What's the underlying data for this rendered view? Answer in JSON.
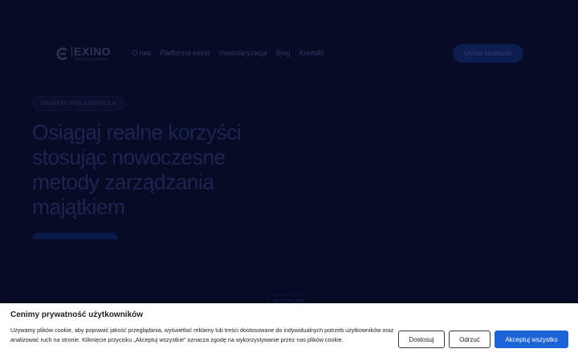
{
  "header": {
    "logo": {
      "name": "EXINO",
      "tagline": "business systems"
    },
    "nav": [
      {
        "label": "O nas"
      },
      {
        "label": "Platforma exino"
      },
      {
        "label": "Inwentaryzacja"
      },
      {
        "label": "Blog"
      },
      {
        "label": "Kontakt"
      }
    ],
    "cta_label": "Umów spotkanie"
  },
  "hero": {
    "badge": "MAJĄTEK POD KONTROLĄ",
    "title": "Osiągaj realne korzyści stosując nowoczesne metody zarządzania majątkiem"
  },
  "section": {
    "badge": "WYZWANIE"
  },
  "cookie_banner": {
    "title": "Cenimy prywatność użytkowników",
    "text": "Używamy plików cookie, aby poprawić jakość przeglądania, wyświetlać reklamy lub treści dostosowane do indywidualnych potrzeb użytkowników oraz analizować ruch na stronie. Kliknięcie przycisku „Akceptuj wszystkie” oznacza zgodę na wykorzystywanie przez nas plików cookie.",
    "customize_label": "Dostosuj",
    "reject_label": "Odrzuć",
    "accept_label": "Akceptuj wszystko"
  },
  "colors": {
    "page_bg": "#070b26",
    "accent": "#1c63d8",
    "overlay_text": "#2f3a66"
  }
}
